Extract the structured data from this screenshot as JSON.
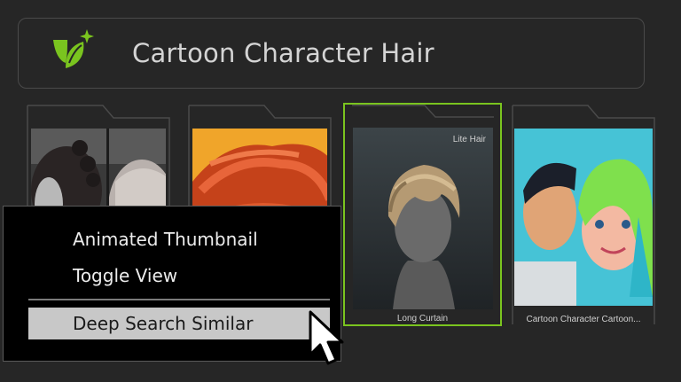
{
  "search": {
    "query": "Cartoon Character Hair"
  },
  "logo": {
    "icon": "plant-sparkle-icon",
    "color": "#7ac41f"
  },
  "cards": [
    {
      "caption": "",
      "selected": false
    },
    {
      "caption": "",
      "selected": false
    },
    {
      "caption": "Long Curtain",
      "badge": "Lite Hair",
      "selected": true
    },
    {
      "caption": "Cartoon Character Cartoon...",
      "selected": false
    }
  ],
  "context_menu": {
    "items": [
      {
        "label": "Animated Thumbnail",
        "highlighted": false
      },
      {
        "label": "Toggle View",
        "highlighted": false
      },
      {
        "label": "Deep Search Similar",
        "highlighted": true
      }
    ]
  },
  "colors": {
    "accent": "#7ac41f",
    "background": "#262626",
    "menu_bg": "#000000",
    "highlight": "#c8c8c8"
  }
}
